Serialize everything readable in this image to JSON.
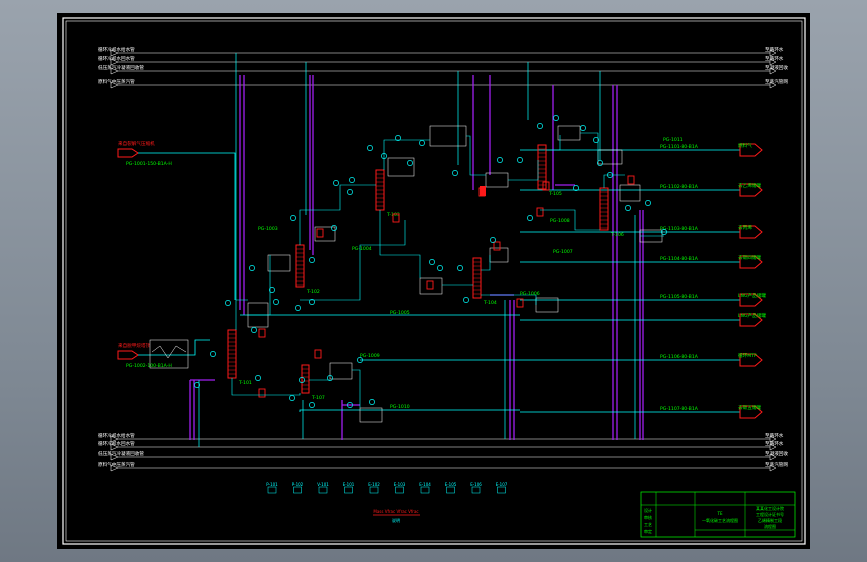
{
  "drawing": {
    "view_title": "PFD-ethylene-refining",
    "background": "#000000",
    "frame_color": "#ffffff",
    "title_block": {
      "title": "TE",
      "subtitle": "一氧化碳工艺流程图",
      "cells": [
        "设计",
        "审核",
        "工艺",
        "审定"
      ],
      "right_lines": [
        "某某化工设计院",
        "工程设计证书号",
        "乙烯精制工段",
        "流程图"
      ]
    }
  },
  "colors": {
    "process_line": "#00ffff",
    "utility_line": "#a020f0",
    "equipment": "#ff1a1a",
    "label": "#00ff00",
    "instrument": "#00ffff",
    "white": "#ffffff"
  },
  "utility_headers": {
    "top_left": [
      "循环冷却水给水管",
      "循环冷却水回水管",
      "低压蒸汽冷凝液回收管",
      "原料气中压蒸汽管"
    ],
    "top_right": [
      "至循环水",
      "至循环水",
      "至凝液回收",
      "至蒸汽管网"
    ],
    "bottom_left": [
      "循环冷却水给水管",
      "循环冷却水回水管",
      "低压蒸汽冷凝液回收管",
      "原料气中压蒸汽管"
    ],
    "bottom_right": [
      "至循环水",
      "至循环水",
      "至凝液回收",
      "至蒸汽管网"
    ]
  },
  "feeds": [
    {
      "label": "来自裂解气压缩机",
      "line_tag": "PG-1001-150-B1A-H"
    },
    {
      "label": "来自脱甲烷塔顶",
      "line_tag": "PG-1002-100-B1A-H"
    }
  ],
  "products": [
    {
      "label": "燃料气",
      "line_tag": "PG-1101-80-B1A"
    },
    {
      "label": "去乙烯储罐",
      "line_tag": "PG-1102-80-B1A"
    },
    {
      "label": "去丙烯",
      "line_tag": "PG-1103-80-B1A"
    },
    {
      "label": "去碳四储罐",
      "line_tag": "PG-1104-80-B1A"
    },
    {
      "label": "LNG产品储罐",
      "line_tag": "PG-1105-80-B1A"
    },
    {
      "label": "LNG产品储罐",
      "line_tag": ""
    },
    {
      "label": "循环MTP",
      "line_tag": "PG-1106-80-B1A"
    },
    {
      "label": "去碳五储罐",
      "line_tag": "PG-1107-80-B1A"
    }
  ],
  "columns": [
    {
      "tag": "T-101"
    },
    {
      "tag": "T-102"
    },
    {
      "tag": "T-103"
    },
    {
      "tag": "T-104"
    },
    {
      "tag": "T-105"
    },
    {
      "tag": "T-106"
    },
    {
      "tag": "T-107"
    }
  ],
  "legend": {
    "symbols": [
      "P-101",
      "P-102",
      "V-101",
      "E-101",
      "E-102",
      "E-103",
      "E-104",
      "E-105",
      "E-106",
      "E-107"
    ],
    "note": "Mass  Vfrac  Vfrac  Vfrac",
    "note2": "说明"
  }
}
